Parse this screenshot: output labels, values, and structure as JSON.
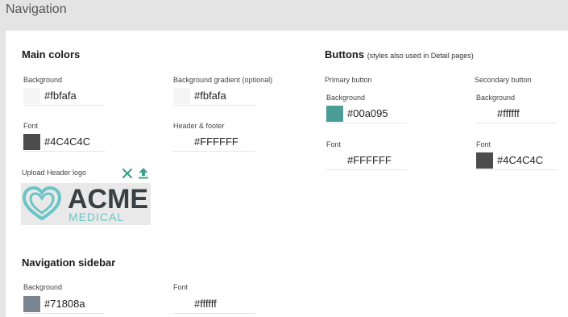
{
  "page": {
    "title": "Navigation"
  },
  "main_colors": {
    "title": "Main colors",
    "background": {
      "label": "Background",
      "value": "#fbfafa",
      "swatch": "#f5f5f5"
    },
    "background_gradient": {
      "label": "Background gradient (optional)",
      "value": "#fbfafa",
      "swatch": "#f5f5f5"
    },
    "font": {
      "label": "Font",
      "value": "#4C4C4C",
      "swatch": "#4C4C4C"
    },
    "header_footer": {
      "label": "Header & footer",
      "value": "#FFFFFF"
    },
    "upload_logo": {
      "label": "Upload Header logo",
      "remove_icon": "close-icon",
      "upload_icon": "upload-icon",
      "logo_text": "ACME",
      "logo_subtext": "MEDICAL"
    }
  },
  "buttons": {
    "title": "Buttons",
    "subtitle": "(styles also used in Detail pages)",
    "primary": {
      "label": "Primary button",
      "background": {
        "label": "Background",
        "value": "#00a095",
        "swatch": "#4a9e96"
      },
      "font": {
        "label": "Font",
        "value": "#FFFFFF"
      }
    },
    "secondary": {
      "label": "Secondary button",
      "background": {
        "label": "Background",
        "value": "#ffffff"
      },
      "font": {
        "label": "Font",
        "value": "#4C4C4C",
        "swatch": "#4C4C4C"
      }
    }
  },
  "nav_sidebar": {
    "title": "Navigation sidebar",
    "background": {
      "label": "Background",
      "value": "#71808a",
      "swatch": "#7a8690"
    },
    "font": {
      "label": "Font",
      "value": "#ffffff"
    }
  },
  "colors": {
    "accent_green": "#3aa08f"
  }
}
